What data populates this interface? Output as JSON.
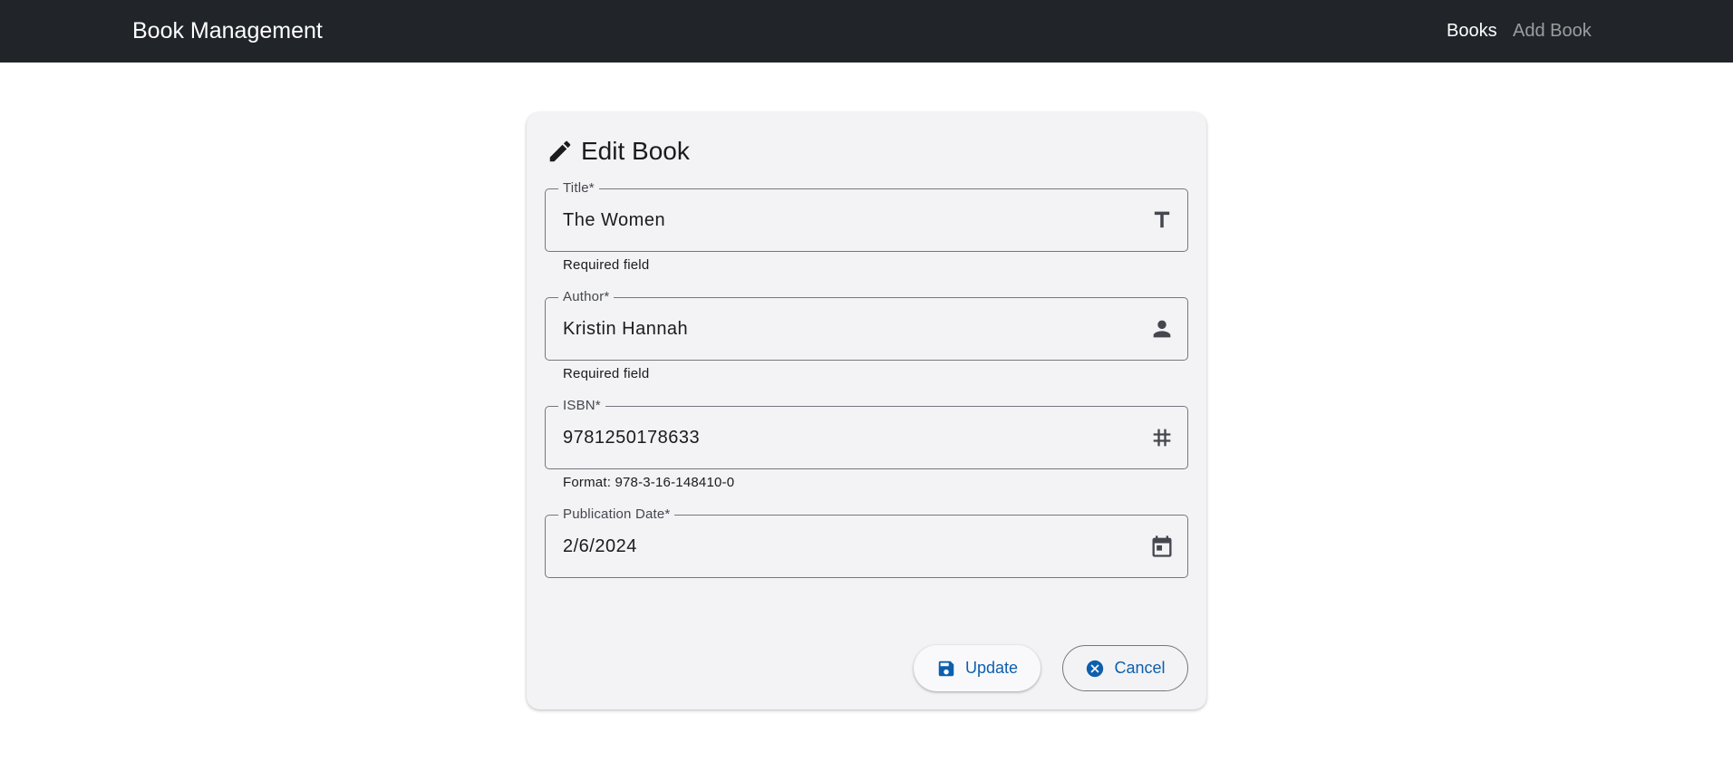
{
  "navbar": {
    "brand": "Book Management",
    "links": [
      {
        "label": "Books",
        "active": true
      },
      {
        "label": "Add Book",
        "active": false
      }
    ]
  },
  "form": {
    "title": "Edit Book",
    "title_icon": "pencil-icon",
    "fields": [
      {
        "label": "Title*",
        "value": "The Women",
        "hint": "Required field",
        "icon": "text-icon"
      },
      {
        "label": "Author*",
        "value": "Kristin Hannah",
        "hint": "Required field",
        "icon": "person-icon"
      },
      {
        "label": "ISBN*",
        "value": "9781250178633",
        "hint": "Format: 978-3-16-148410-0",
        "icon": "hash-icon"
      },
      {
        "label": "Publication Date*",
        "value": "2/6/2024",
        "hint": "",
        "icon": "calendar-icon"
      }
    ],
    "buttons": {
      "update": {
        "label": "Update",
        "icon": "save-icon"
      },
      "cancel": {
        "label": "Cancel",
        "icon": "cancel-circle-icon"
      }
    }
  },
  "colors": {
    "navbar_bg": "#212529",
    "card_bg": "#f3f3f5",
    "button_text": "#0d5fad",
    "outline": "#74777f"
  }
}
